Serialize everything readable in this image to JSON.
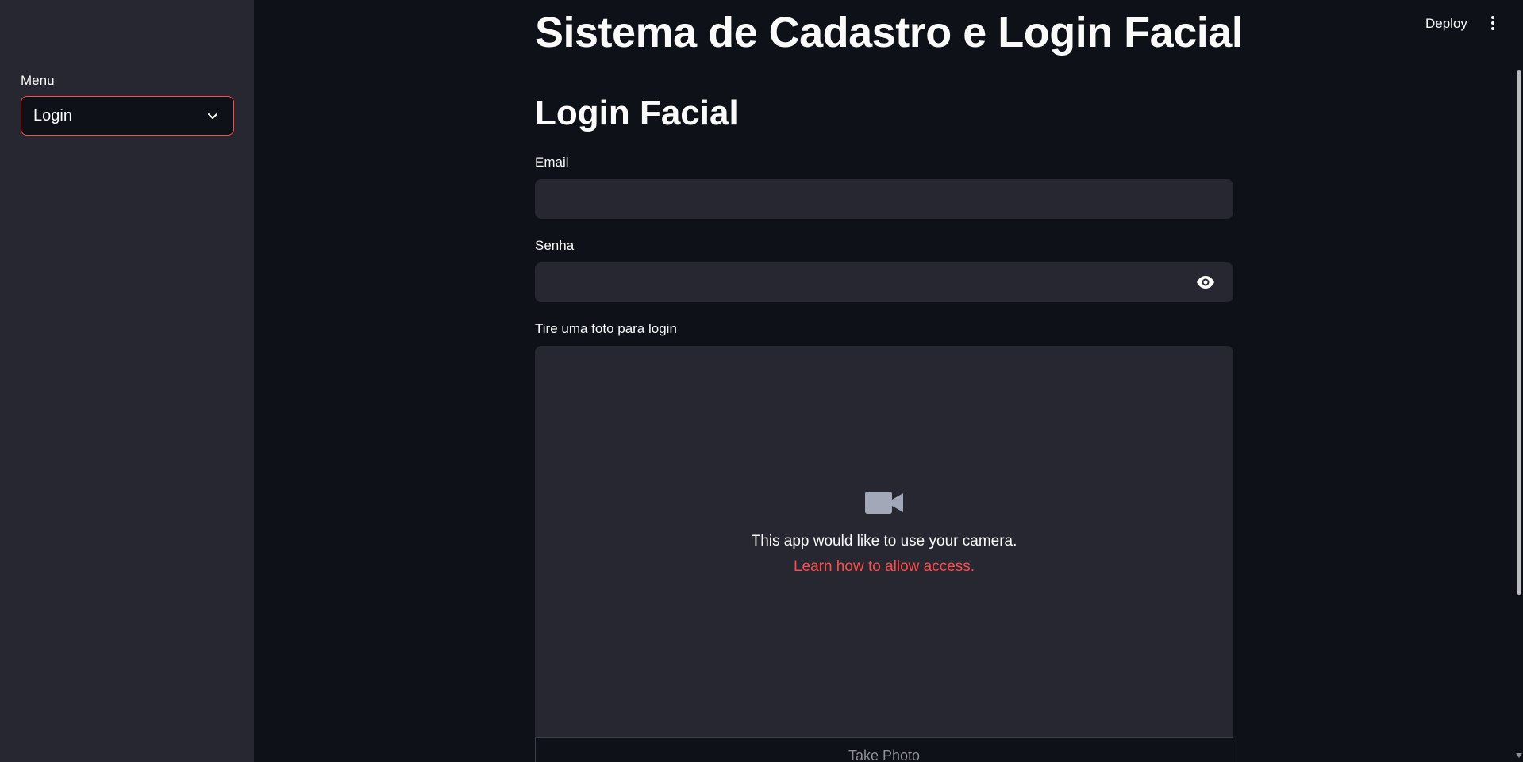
{
  "sidebar": {
    "menu_label": "Menu",
    "select_value": "Login"
  },
  "header": {
    "deploy_label": "Deploy"
  },
  "main": {
    "title": "Sistema de Cadastro e Login Facial",
    "section_title": "Login Facial",
    "email_label": "Email",
    "email_value": "",
    "password_label": "Senha",
    "password_value": "",
    "camera_label": "Tire uma foto para login",
    "camera_message": "This app would like to use your camera.",
    "camera_link": "Learn how to allow access.",
    "take_photo_label": "Take Photo"
  },
  "icons": {
    "chevron": "chevron-down-icon",
    "kebab": "more-vertical-icon",
    "eye": "eye-icon",
    "camera": "video-camera-icon"
  },
  "colors": {
    "background": "#0e1117",
    "sidebar": "#262730",
    "accent": "#ff4b4b",
    "text": "#fafafa",
    "muted": "#8e8f96"
  }
}
